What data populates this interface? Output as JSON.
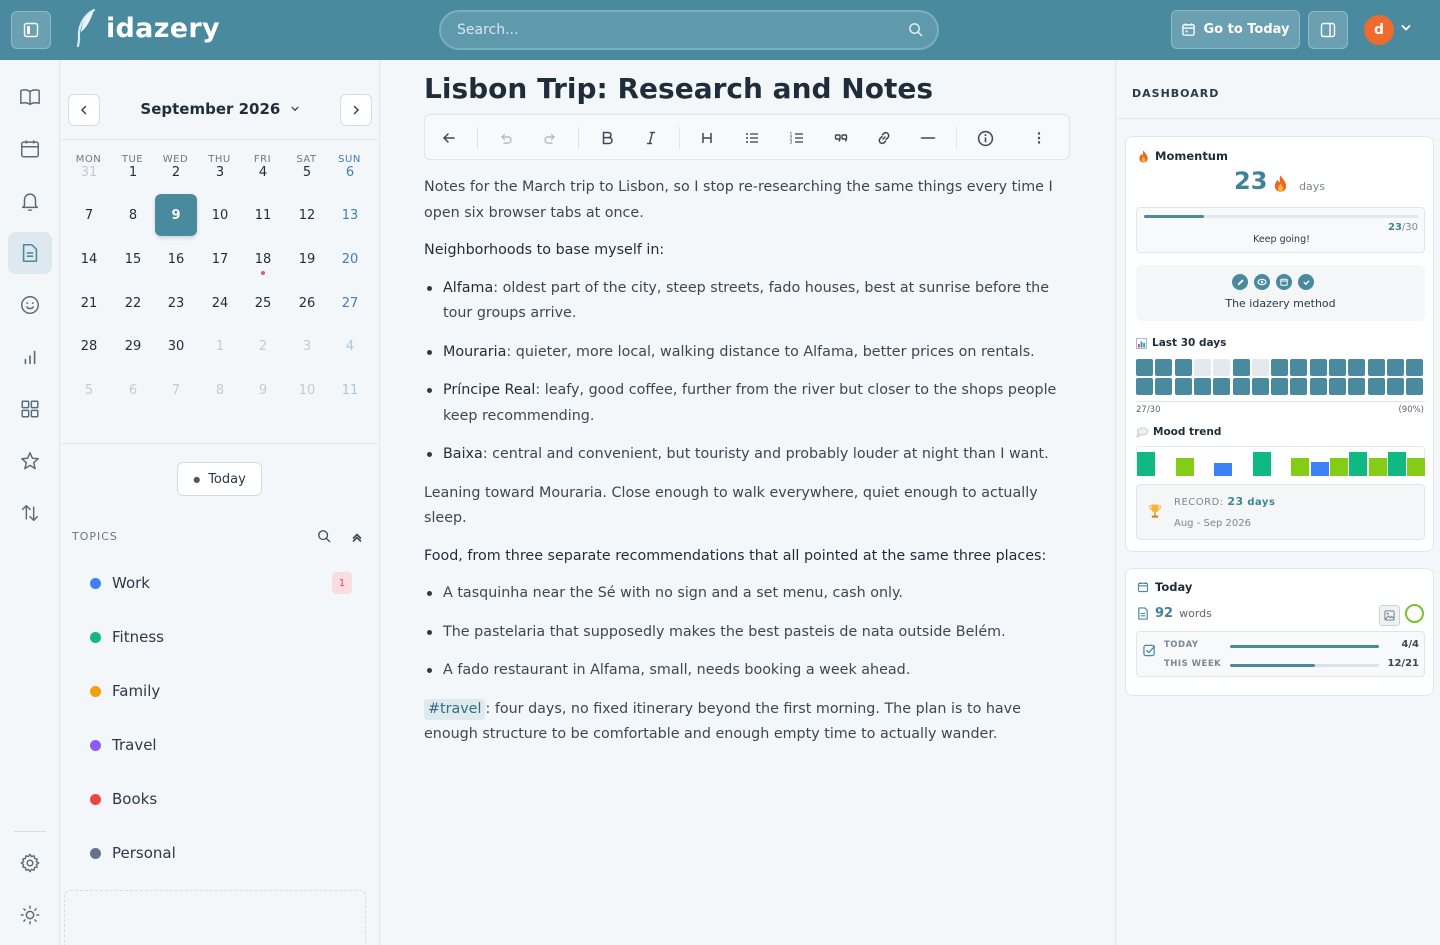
{
  "app": {
    "name": "idazery",
    "search_placeholder": "Search...",
    "goto_today_label": "Go to Today",
    "avatar_initial": "d",
    "accent_color": "#4a8a9e"
  },
  "rail": {
    "items": [
      "book-open-icon",
      "calendar-icon",
      "bell-icon",
      "document-icon",
      "smile-icon",
      "bar-chart-icon",
      "grid-icon",
      "star-icon",
      "sort-arrows-icon"
    ],
    "bottom": [
      "settings-icon",
      "sun-icon"
    ]
  },
  "calendar": {
    "title": "September 2026",
    "weekdays": [
      "MON",
      "TUE",
      "WED",
      "THU",
      "FRI",
      "SAT",
      "SUN"
    ],
    "weeks": [
      [
        "31",
        "1",
        "2",
        "3",
        "4",
        "5",
        "6"
      ],
      [
        "7",
        "8",
        "9",
        "10",
        "11",
        "12",
        "13"
      ],
      [
        "14",
        "15",
        "16",
        "17",
        "18",
        "19",
        "20"
      ],
      [
        "21",
        "22",
        "23",
        "24",
        "25",
        "26",
        "27"
      ],
      [
        "28",
        "29",
        "30",
        "1",
        "2",
        "3",
        "4"
      ],
      [
        "5",
        "6",
        "7",
        "8",
        "9",
        "10",
        "11"
      ]
    ],
    "selected_day": "9",
    "today_label": "Today"
  },
  "topics": {
    "heading": "TOPICS",
    "items": [
      {
        "label": "Work",
        "color": "#3b82f6"
      },
      {
        "label": "Fitness",
        "color": "#10b981"
      },
      {
        "label": "Family",
        "color": "#f59e0b"
      },
      {
        "label": "Travel",
        "color": "#8b5cf6"
      },
      {
        "label": "Books",
        "color": "#ef4444"
      },
      {
        "label": "Personal",
        "color": "#64748b"
      }
    ],
    "work_badge": "1"
  },
  "editor": {
    "title": "Lisbon Trip: Research and Notes",
    "toolbar": [
      "back-arrow-icon",
      "undo-icon",
      "redo-icon",
      "bold-icon",
      "italic-icon",
      "heading-icon",
      "bullet-list-icon",
      "numbered-list-icon",
      "quote-icon",
      "link-icon",
      "horizontal-rule-icon",
      "info-icon",
      "more-vertical-icon"
    ],
    "intro": "Notes for the March trip to Lisbon, so I stop re-researching the same things every time I open six browser tabs at once.",
    "neighborhoods_heading": "Neighborhoods to base myself in:",
    "neighborhoods": [
      {
        "name": "Alfama",
        "text": ": oldest part of the city, steep streets, fado houses, best at sunrise before the tour groups arrive."
      },
      {
        "name": "Mouraria",
        "text": ": quieter, more local, walking distance to Alfama, better prices on rentals."
      },
      {
        "name": "Príncipe Real",
        "text": ": leafy, good coffee, further from the river but closer to the shops people keep recommending."
      },
      {
        "name": "Baixa",
        "text": ": central and convenient, but touristy and probably louder at night than I want."
      }
    ],
    "leaning": "Leaning toward Mouraria. Close enough to walk everywhere, quiet enough to actually sleep.",
    "food_heading": "Food, from three separate recommendations that all pointed at the same three places:",
    "food": [
      "A tasquinha near the Sé with no sign and a set menu, cash only.",
      "The pastelaria that supposedly makes the best pasteis de nata outside Belém.",
      "A fado restaurant in Alfama, small, needs booking a week ahead."
    ],
    "tag": "#travel",
    "closing": ": four days, no fixed itinerary beyond the first morning. The plan is to have enough structure to be comfortable and enough empty time to actually wander."
  },
  "dashboard": {
    "heading": "DASHBOARD",
    "momentum": {
      "title": "Momentum",
      "streak": "23",
      "unit": "days",
      "progress": "23",
      "goal": "/30",
      "progress_fraction": 0.2167,
      "message": "Keep going!",
      "method_label": "The idazery method"
    },
    "last30": {
      "title": "Last 30 days",
      "count": "27/30",
      "percent": "(90%)",
      "cells": [
        1,
        1,
        1,
        0,
        0,
        1,
        0,
        1,
        1,
        1,
        1,
        1,
        1,
        1,
        1,
        1,
        1,
        1,
        1,
        1,
        1,
        1,
        1,
        1,
        1,
        1,
        1,
        1,
        1,
        1
      ],
      "filled_color": "#4a8a9e",
      "empty_color": "#e3e9ed"
    },
    "mood": {
      "title": "Mood trend",
      "levels": [
        0.85,
        0,
        0.65,
        0,
        0.45,
        0,
        0.85,
        0,
        0.65,
        0.5,
        0.65,
        0.85,
        0.65,
        0.85,
        0.65
      ],
      "colors": [
        "#10b981",
        "#fff",
        "#84cc16",
        "#fff",
        "#3b82f6",
        "#fff",
        "#10b981",
        "#fff",
        "#84cc16",
        "#3b82f6",
        "#84cc16",
        "#10b981",
        "#84cc16",
        "#10b981",
        "#84cc16"
      ]
    },
    "record": {
      "label": "RECORD:",
      "value": "23",
      "unit": "days",
      "range": "Aug - Sep 2026"
    },
    "today": {
      "title": "Today",
      "words_count": "92",
      "words_label": "words",
      "today_label": "TODAY",
      "today_value": "4/4",
      "today_fraction": 1.0,
      "week_label": "THIS WEEK",
      "week_value": "12/21",
      "week_fraction": 0.571
    }
  }
}
